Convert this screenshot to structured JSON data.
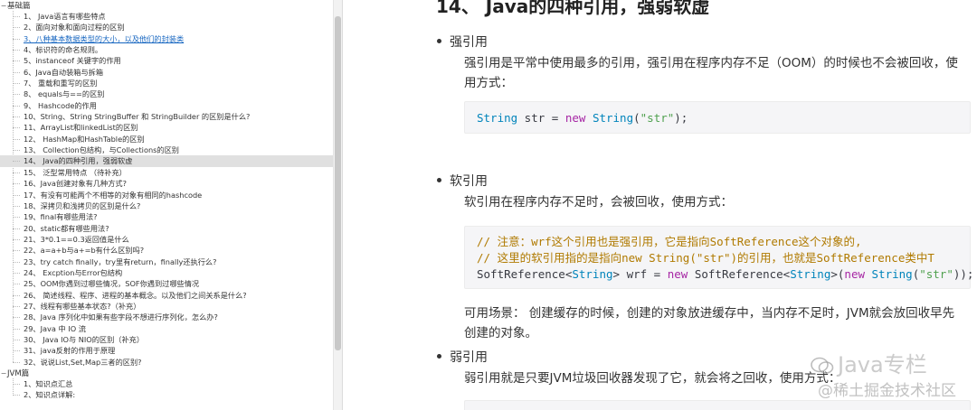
{
  "sidebar": {
    "groups": [
      {
        "label": "基础篇",
        "toggle": "−",
        "items": [
          {
            "label": "1、 Java语言有哪些特点"
          },
          {
            "label": "2、面向对象和面向过程的区别"
          },
          {
            "label": "3、八种基本数据类型的大小，以及他们的封装类",
            "link": true
          },
          {
            "label": "4、标识符的命名规则。"
          },
          {
            "label": "5、instanceof 关键字的作用"
          },
          {
            "label": "6、Java自动装箱与拆箱"
          },
          {
            "label": "7、 重载和重写的区别"
          },
          {
            "label": "8、 equals与==的区别"
          },
          {
            "label": "9、 Hashcode的作用"
          },
          {
            "label": "10、String、String StringBuffer 和 StringBuilder 的区别是什么?"
          },
          {
            "label": "11、ArrayList和linkedList的区别"
          },
          {
            "label": "12、 HashMap和HashTable的区别"
          },
          {
            "label": "13、 Collection包结构，与Collections的区别"
          },
          {
            "label": "14、 Java的四种引用，强弱软虚",
            "selected": true
          },
          {
            "label": "15、 泛型常用特点 （待补充）"
          },
          {
            "label": "16、Java创建对象有几种方式?"
          },
          {
            "label": "17、有没有可能两个不相等的对象有相同的hashcode"
          },
          {
            "label": "18、深拷贝和浅拷贝的区别是什么?"
          },
          {
            "label": "19、final有哪些用法?"
          },
          {
            "label": "20、static都有哪些用法?"
          },
          {
            "label": "21、3*0.1==0.3返回值是什么"
          },
          {
            "label": "22、a=a+b与a+=b有什么区别吗?"
          },
          {
            "label": "23、try catch finally，try里有return，finally还执行么?"
          },
          {
            "label": "24、 Excption与Error包结构"
          },
          {
            "label": "25、OOM你遇到过哪些情况，SOF你遇到过哪些情况"
          },
          {
            "label": "26、 简述线程、程序、进程的基本概念。以及他们之间关系是什么?"
          },
          {
            "label": "27、线程有哪些基本状态?（补充）"
          },
          {
            "label": "28、Java 序列化中如果有些字段不想进行序列化，怎么办?"
          },
          {
            "label": "29、Java 中 IO 流"
          },
          {
            "label": "30、 Java IO与 NIO的区别（补充）"
          },
          {
            "label": "31、java反射的作用于原理"
          },
          {
            "label": "32、说说List,Set,Map三者的区别?"
          }
        ]
      },
      {
        "label": "JVM篇",
        "toggle": "−",
        "items": [
          {
            "label": "1、知识点汇总"
          },
          {
            "label": "2、知识点详解:"
          }
        ]
      }
    ]
  },
  "article": {
    "heading": "14、 Java的四种引用，强弱软虚",
    "sections": [
      {
        "bullet": "强引用",
        "text": "强引用是平常中使用最多的引用，强引用在程序内存不足（OOM）的时候也不会被回收，使用方式："
      },
      {
        "bullet": "软引用",
        "text": "软引用在程序内存不足时，会被回收，使用方式："
      },
      {
        "bullet": "弱引用",
        "text": "弱引用就是只要JVM垃圾回收器发现了它，就会将之回收，使用方式："
      }
    ],
    "code1": {
      "type": "String",
      "var": " str = ",
      "kw": "new",
      "type2": " String",
      "paren_open": "(",
      "str": "\"str\"",
      "end": ");"
    },
    "code2": {
      "comment1": "// 注意：wrf这个引用也是强引用，它是指向SoftReference这个对象的,",
      "comment2": "// 这里的软引用指的是指向new String(\"str\")的引用，也就是SoftReference类中T",
      "l3_a": "SoftReference<",
      "l3_b": "String",
      "l3_c": "> wrf = ",
      "l3_d": "new",
      "l3_e": " SoftReference<",
      "l3_f": "String",
      "l3_g": ">(",
      "l3_h": "new",
      "l3_i": " String",
      "l3_j": "(",
      "l3_k": "\"str\"",
      "l3_l": "));"
    },
    "usage": "可用场景： 创建缓存的时候，创建的对象放进缓存中，当内存不足时，JVM就会放回收早先创建的对象。"
  },
  "watermark": {
    "line1": "Java专栏",
    "line2": "@稀土掘金技术社区"
  }
}
